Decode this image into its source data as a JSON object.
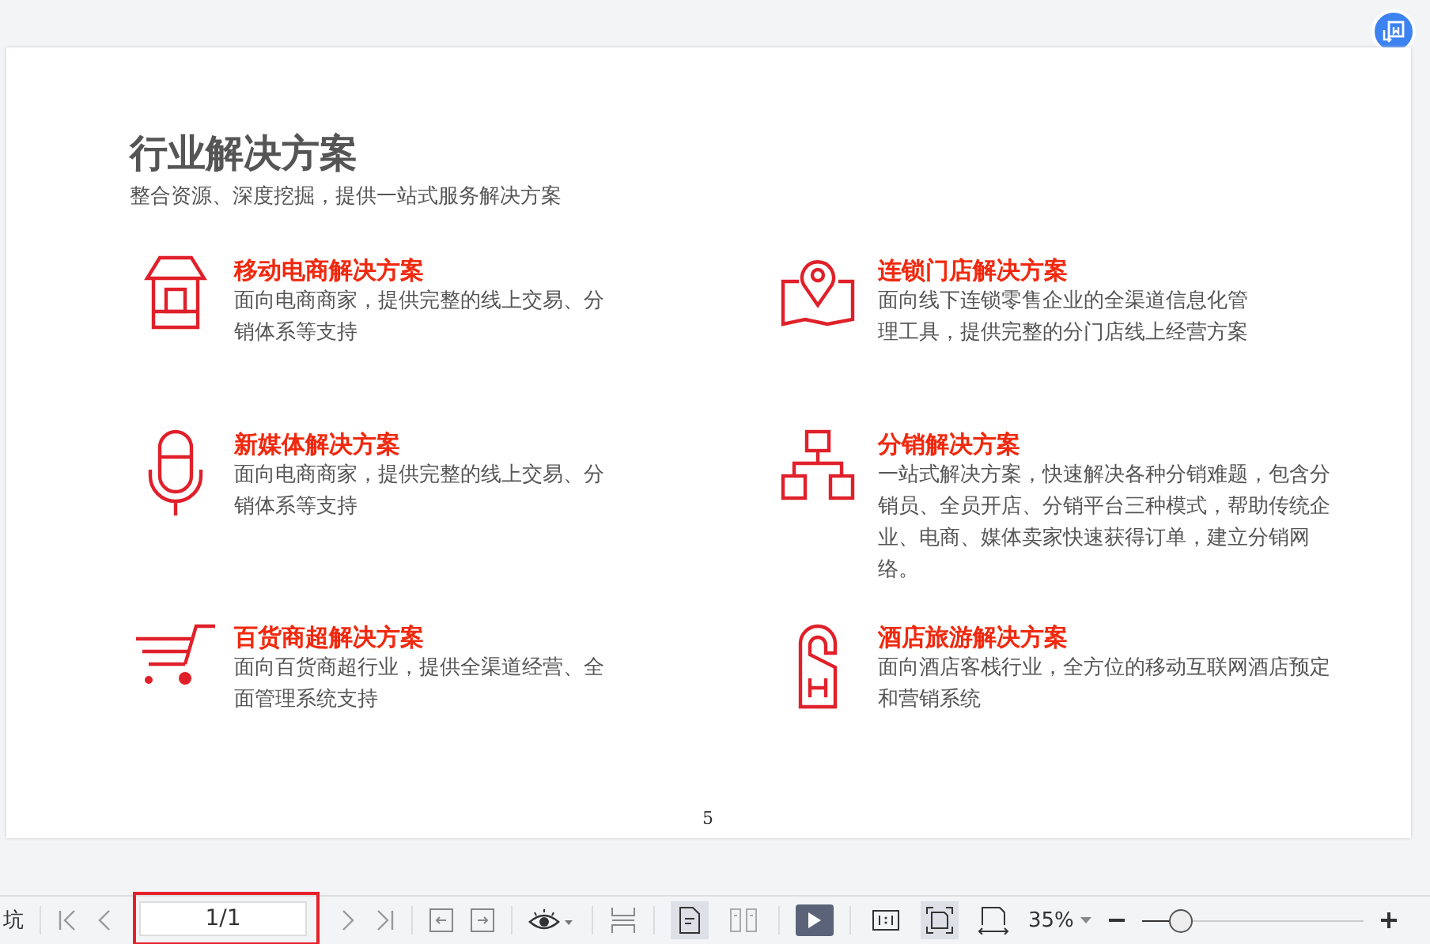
{
  "page": {
    "title": "行业解决方案",
    "subtitle": "整合资源、深度挖掘，提供一站式服务解决方案",
    "page_number": "5",
    "solutions": [
      {
        "kind": "shop",
        "title": "移动电商解决方案",
        "description": "面向电商商家，提供完整的线上交易、分销体系等支持"
      },
      {
        "kind": "map",
        "title": "连锁门店解决方案",
        "description": "面向线下连锁零售企业的全渠道信息化管理工具，提供完整的分门店线上经营方案"
      },
      {
        "kind": "mic",
        "title": "新媒体解决方案",
        "description": "面向电商商家，提供完整的线上交易、分销体系等支持"
      },
      {
        "kind": "tree",
        "title": "分销解决方案",
        "description": "一站式解决方案，快速解决各种分销难题，包含分销员、全员开店、分销平台三种模式，帮助传统企业、电商、媒体卖家快速获得订单，建立分销网络。"
      },
      {
        "kind": "cart",
        "title": "百货商超解决方案",
        "description": "面向百货商超行业，提供全渠道经营、全面管理系统支持"
      },
      {
        "kind": "hanger",
        "title": "酒店旅游解决方案",
        "description": "面向酒店客栈行业，全方位的移动互联网酒店预定和营销系统"
      }
    ]
  },
  "toolbar": {
    "left_text": "坑",
    "page_field": "1/1",
    "highlighted": true,
    "view_modes": [
      {
        "kind": "single",
        "selected": true
      },
      {
        "kind": "double",
        "selected": false
      }
    ],
    "fit_modes": [
      {
        "kind": "actual",
        "selected": false
      },
      {
        "kind": "page",
        "selected": true
      },
      {
        "kind": "width",
        "selected": false
      }
    ],
    "zoom": "35%",
    "zoom_slider": {
      "level": 0.17
    }
  }
}
